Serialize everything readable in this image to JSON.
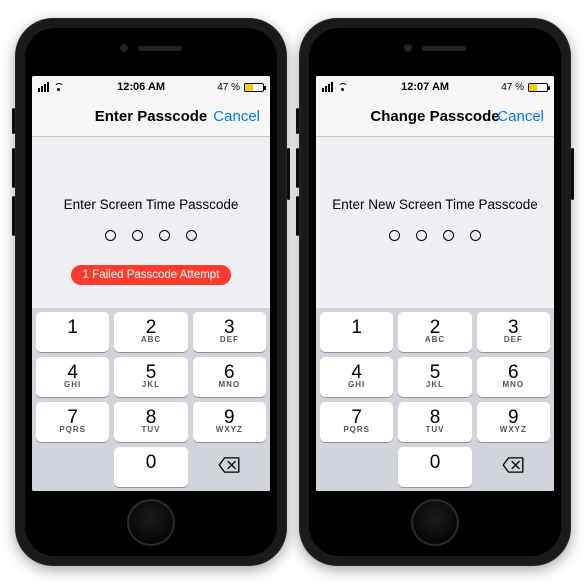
{
  "phones": [
    {
      "status": {
        "time": "12:06 AM",
        "battery_text": "47 %",
        "battery_fill_pct": 47
      },
      "nav": {
        "title": "Enter Passcode",
        "cancel": "Cancel"
      },
      "prompt": "Enter Screen Time Passcode",
      "error": "1 Failed Passcode Attempt",
      "show_error": true
    },
    {
      "status": {
        "time": "12:07 AM",
        "battery_text": "47 %",
        "battery_fill_pct": 47
      },
      "nav": {
        "title": "Change Passcode",
        "cancel": "Cancel"
      },
      "prompt": "Enter New Screen Time Passcode",
      "error": "",
      "show_error": false
    }
  ],
  "keypad": [
    {
      "num": "1",
      "letters": ""
    },
    {
      "num": "2",
      "letters": "ABC"
    },
    {
      "num": "3",
      "letters": "DEF"
    },
    {
      "num": "4",
      "letters": "GHI"
    },
    {
      "num": "5",
      "letters": "JKL"
    },
    {
      "num": "6",
      "letters": "MNO"
    },
    {
      "num": "7",
      "letters": "PQRS"
    },
    {
      "num": "8",
      "letters": "TUV"
    },
    {
      "num": "9",
      "letters": "WXYZ"
    },
    {
      "num": "0",
      "letters": ""
    }
  ]
}
